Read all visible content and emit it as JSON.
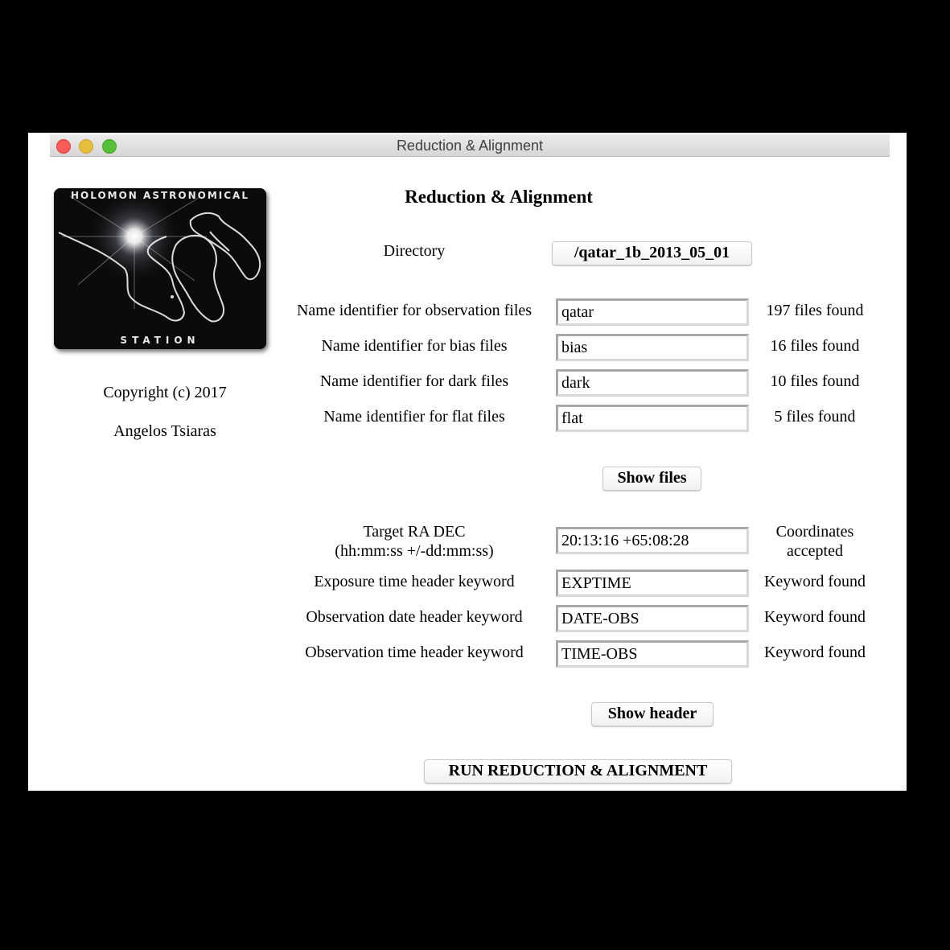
{
  "window": {
    "title": "Reduction & Alignment"
  },
  "logo": {
    "top_text": "HOLOMON ASTRONOMICAL",
    "bottom_text": "STATION"
  },
  "sidebar": {
    "copyright": "Copyright (c) 2017",
    "author": "Angelos Tsiaras"
  },
  "main": {
    "heading": "Reduction & Alignment",
    "directory_label": "Directory",
    "directory_button": "/qatar_1b_2013_05_01",
    "file_rows": [
      {
        "label": "Name identifier for observation files",
        "value": "qatar",
        "status": "197 files found"
      },
      {
        "label": "Name identifier for bias files",
        "value": "bias",
        "status": "16 files found"
      },
      {
        "label": "Name identifier for dark files",
        "value": "dark",
        "status": "10 files found"
      },
      {
        "label": "Name identifier for flat files",
        "value": "flat",
        "status": "5 files found"
      }
    ],
    "show_files_button": "Show files",
    "target": {
      "label_line1": "Target RA DEC",
      "label_line2": "(hh:mm:ss +/-dd:mm:ss)",
      "value": "20:13:16 +65:08:28",
      "status_line1": "Coordinates",
      "status_line2": "accepted"
    },
    "header_rows": [
      {
        "label": "Exposure time header keyword",
        "value": "EXPTIME",
        "status": "Keyword found"
      },
      {
        "label": "Observation date header keyword",
        "value": "DATE-OBS",
        "status": "Keyword found"
      },
      {
        "label": "Observation time header keyword",
        "value": "TIME-OBS",
        "status": "Keyword found"
      }
    ],
    "show_header_button": "Show header",
    "run_button": "RUN REDUCTION & ALIGNMENT"
  }
}
